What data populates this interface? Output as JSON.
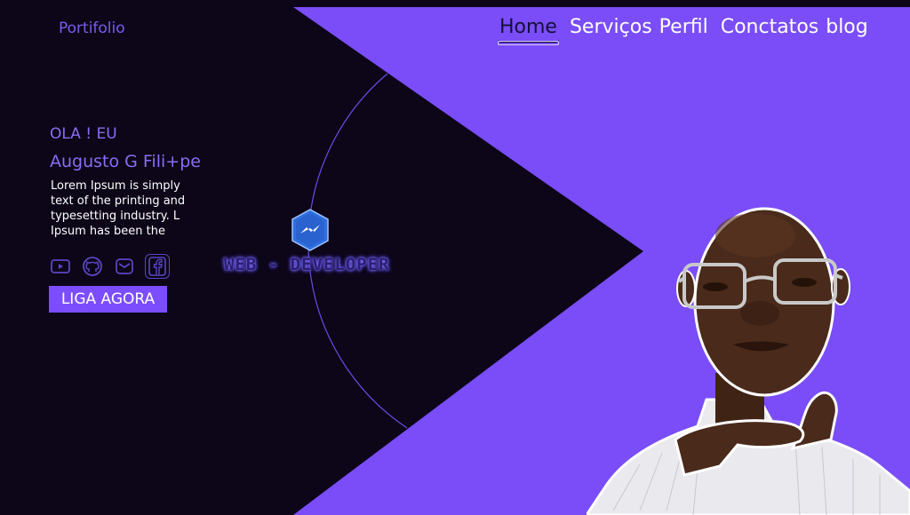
{
  "brand": {
    "title": "Portifolio"
  },
  "nav": {
    "items": [
      {
        "label": "Home",
        "active": true
      },
      {
        "label": "Serviços"
      },
      {
        "label": "Perfil"
      },
      {
        "label": "Conctatos"
      },
      {
        "label": "blog"
      }
    ]
  },
  "hero": {
    "greeting": "OLA ! EU",
    "name": "Augusto G Fili+pe",
    "intro": "Lorem Ipsum is simply text of the printing and typesetting industry. L Ipsum has been the",
    "cta_label": "LIGA AGORA",
    "tagline": "WEB - DEVELOPER"
  },
  "socials": [
    {
      "icon": "youtube-icon"
    },
    {
      "icon": "github-icon"
    },
    {
      "icon": "mail-icon"
    },
    {
      "icon": "facebook-icon"
    }
  ],
  "colors": {
    "background": "#0c0618",
    "accent": "#7a4df8",
    "text_accent": "#8a6cf7",
    "badge": "#2f6fe0"
  }
}
